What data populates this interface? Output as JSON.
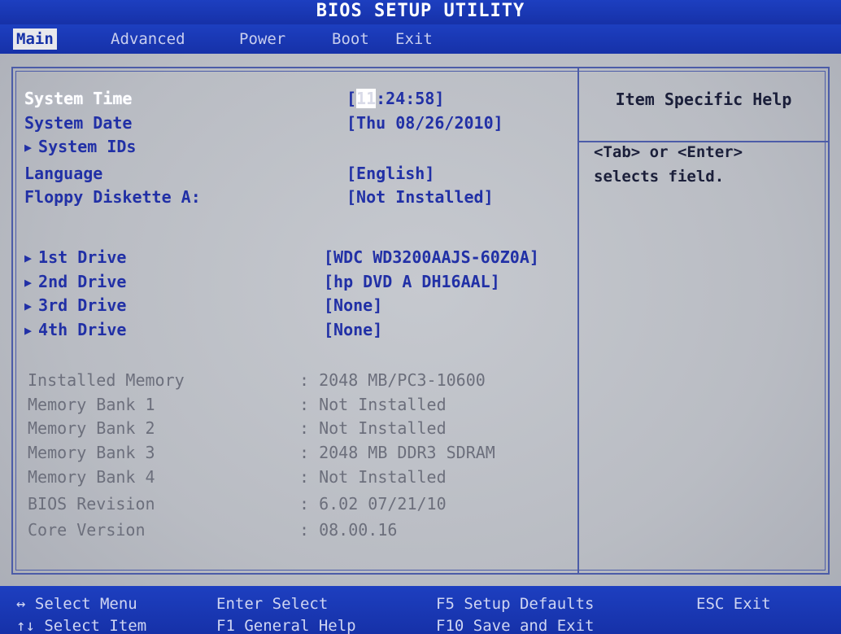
{
  "title": "BIOS SETUP UTILITY",
  "menu": {
    "main": "Main",
    "advanced": "Advanced",
    "power": "Power",
    "boot": "Boot",
    "exit": "Exit"
  },
  "settings": {
    "system_time": {
      "label": "System Time",
      "value_open": "[",
      "value_hl": "11",
      "value_rest": ":24:58]"
    },
    "system_date": {
      "label": "System Date",
      "value": "[Thu 08/26/2010]"
    },
    "system_ids": {
      "label": "System IDs"
    },
    "language": {
      "label": "Language",
      "value": "[English]"
    },
    "floppy": {
      "label": "Floppy Diskette A:",
      "value": "[Not Installed]"
    },
    "drive1": {
      "label": "1st Drive",
      "value": "[WDC WD3200AAJS-60Z0A]"
    },
    "drive2": {
      "label": "2nd Drive",
      "value": "[hp DVD A DH16AAL]"
    },
    "drive3": {
      "label": "3rd Drive",
      "value": "[None]"
    },
    "drive4": {
      "label": "4th Drive",
      "value": "[None]"
    }
  },
  "info": [
    {
      "label": "Installed Memory",
      "value": ": 2048 MB/PC3-10600"
    },
    {
      "label": "Memory Bank 1",
      "value": ": Not Installed"
    },
    {
      "label": "Memory Bank 2",
      "value": ": Not Installed"
    },
    {
      "label": "Memory Bank 3",
      "value": ": 2048 MB DDR3 SDRAM"
    },
    {
      "label": "Memory Bank 4",
      "value": ": Not Installed"
    },
    {
      "label": "BIOS Revision",
      "value": ": 6.02 07/21/10"
    },
    {
      "label": "Core Version",
      "value": ": 08.00.16"
    }
  ],
  "help": {
    "title": "Item Specific Help",
    "line1": "<Tab> or <Enter>",
    "line2": "selects field."
  },
  "footer": {
    "select_menu": "↔ Select Menu",
    "select_item": "↑↓ Select Item",
    "enter_select": "Enter Select",
    "f1_help": "F1   General Help",
    "f5_defaults": "F5  Setup Defaults",
    "f10_save": "F10 Save and Exit",
    "esc_exit": "ESC Exit"
  },
  "icons": {
    "submenu_arrow": "triangle-right"
  },
  "colors": {
    "bar_blue": "#1631a8",
    "panel_gray": "#c0c3ca",
    "setting_blue": "#2130a6",
    "info_gray": "#6c6f7c",
    "selected_white": "#ffffff"
  }
}
